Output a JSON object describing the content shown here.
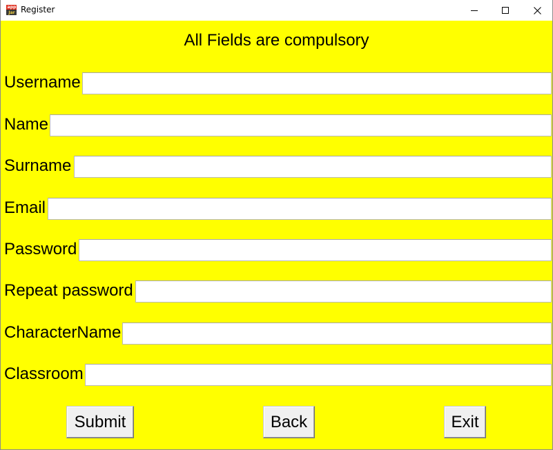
{
  "window": {
    "title": "Register",
    "icon": "appjar-icon",
    "icon_text_top": "app",
    "icon_text_bottom": "Jar",
    "controls": [
      "minimize-icon",
      "maximize-icon",
      "close-icon"
    ]
  },
  "form": {
    "heading": "All Fields are compulsory",
    "fields": [
      {
        "label": "Username",
        "value": ""
      },
      {
        "label": "Name",
        "value": ""
      },
      {
        "label": "Surname",
        "value": ""
      },
      {
        "label": "Email",
        "value": ""
      },
      {
        "label": "Password",
        "value": ""
      },
      {
        "label": "Repeat password",
        "value": ""
      },
      {
        "label": "CharacterName",
        "value": ""
      },
      {
        "label": "Classroom",
        "value": ""
      }
    ]
  },
  "buttons": {
    "submit": "Submit",
    "back": "Back",
    "exit": "Exit"
  },
  "colors": {
    "background": "#ffff00",
    "field_background": "#ffffff",
    "button_background": "#f0f0f0"
  }
}
